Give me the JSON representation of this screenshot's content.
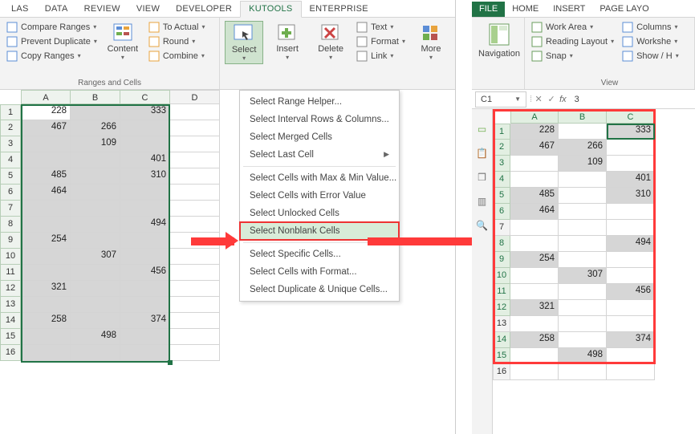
{
  "left": {
    "tabs": [
      "LAS",
      "DATA",
      "REVIEW",
      "VIEW",
      "DEVELOPER",
      "KUTOOLS",
      "ENTERPRISE"
    ],
    "active_tab": 5,
    "ranges_group": {
      "label": "Ranges and Cells",
      "col1": [
        "Compare Ranges",
        "Prevent Duplicate",
        "Copy Ranges"
      ],
      "content_btn": "Content",
      "col3": [
        "To Actual",
        "Round",
        "Combine"
      ]
    },
    "editing_group": {
      "select": "Select",
      "insert": "Insert",
      "delete": "Delete",
      "col4": [
        "Text",
        "Format",
        "Link"
      ],
      "more": "More"
    },
    "menu": {
      "items": [
        "Select Range Helper...",
        "Select Interval Rows & Columns...",
        "Select Merged Cells",
        "Select Last Cell",
        "Select Cells with Max & Min Value...",
        "Select Cells with Error Value",
        "Select Unlocked Cells",
        "Select Nonblank Cells",
        "Select Specific Cells...",
        "Select Cells with Format...",
        "Select Duplicate & Unique Cells..."
      ],
      "highlight": 7,
      "submenu_at": 3
    },
    "grid": {
      "cols": [
        "A",
        "B",
        "C",
        "D"
      ],
      "rows": [
        "1",
        "2",
        "3",
        "4",
        "5",
        "6",
        "7",
        "8",
        "9",
        "10",
        "11",
        "12",
        "13",
        "14",
        "15",
        "16"
      ],
      "data": [
        [
          "228",
          "",
          "333"
        ],
        [
          "467",
          "266",
          ""
        ],
        [
          "",
          "109",
          ""
        ],
        [
          "",
          "",
          "401"
        ],
        [
          "485",
          "",
          "310"
        ],
        [
          "464",
          "",
          ""
        ],
        [
          "",
          "",
          ""
        ],
        [
          "",
          "",
          "494"
        ],
        [
          "254",
          "",
          ""
        ],
        [
          "",
          "307",
          ""
        ],
        [
          "",
          "",
          "456"
        ],
        [
          "321",
          "",
          ""
        ],
        [
          "",
          "",
          ""
        ],
        [
          "258",
          "",
          "374"
        ],
        [
          "",
          "498",
          ""
        ],
        [
          "",
          "",
          ""
        ]
      ]
    }
  },
  "right": {
    "tabs": [
      "FILE",
      "HOME",
      "INSERT",
      "PAGE LAYO"
    ],
    "view_group_label": "View",
    "nav_btn": "Navigation",
    "col2": [
      "Work Area",
      "Reading Layout",
      "Snap"
    ],
    "col3": [
      "Columns",
      "Workshe",
      "Show / H"
    ],
    "namebox": "C1",
    "formula_value": "3",
    "grid": {
      "cols": [
        "A",
        "B",
        "C"
      ],
      "rows": [
        "1",
        "2",
        "3",
        "4",
        "5",
        "6",
        "7",
        "8",
        "9",
        "10",
        "11",
        "12",
        "13",
        "14",
        "15",
        "16"
      ],
      "data": [
        [
          "228",
          "",
          "333"
        ],
        [
          "467",
          "266",
          ""
        ],
        [
          "",
          "109",
          ""
        ],
        [
          "",
          "",
          "401"
        ],
        [
          "485",
          "",
          "310"
        ],
        [
          "464",
          "",
          ""
        ],
        [
          "",
          "",
          ""
        ],
        [
          "",
          "",
          "494"
        ],
        [
          "254",
          "",
          ""
        ],
        [
          "",
          "307",
          ""
        ],
        [
          "",
          "",
          "456"
        ],
        [
          "321",
          "",
          ""
        ],
        [
          "",
          "",
          ""
        ],
        [
          "258",
          "",
          "374"
        ],
        [
          "",
          "498",
          ""
        ],
        [
          "",
          "",
          ""
        ]
      ],
      "selected": [
        [
          1,
          0,
          1
        ],
        [
          1,
          1,
          0
        ],
        [
          0,
          1,
          0
        ],
        [
          0,
          0,
          1
        ],
        [
          1,
          0,
          1
        ],
        [
          1,
          0,
          0
        ],
        [
          0,
          0,
          0
        ],
        [
          0,
          0,
          1
        ],
        [
          1,
          0,
          0
        ],
        [
          0,
          1,
          0
        ],
        [
          0,
          0,
          1
        ],
        [
          1,
          0,
          0
        ],
        [
          0,
          0,
          0
        ],
        [
          1,
          0,
          1
        ],
        [
          0,
          1,
          0
        ],
        [
          0,
          0,
          0
        ]
      ],
      "row_sel": [
        1,
        1,
        1,
        1,
        1,
        1,
        0,
        1,
        1,
        1,
        1,
        1,
        0,
        1,
        1,
        0
      ]
    }
  }
}
